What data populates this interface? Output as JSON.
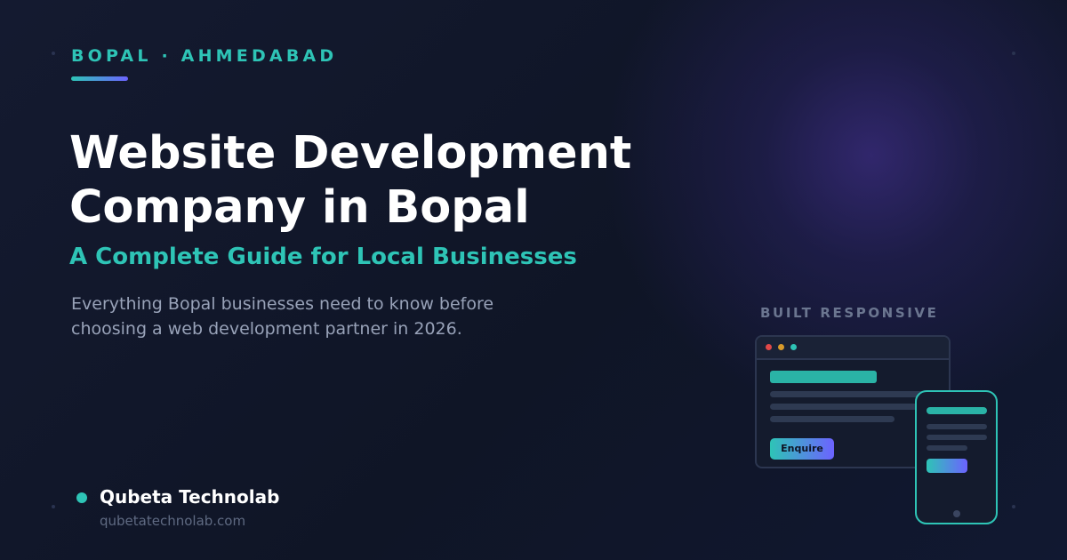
{
  "location": {
    "label": "BOPAL · AHMEDABAD"
  },
  "hero": {
    "title_lines": [
      "Website Development",
      "Company in Bopal"
    ],
    "subtitle": "A Complete Guide for Local Businesses",
    "description_lines": [
      "Everything Bopal businesses need to know before",
      "choosing a web development partner in 2026."
    ]
  },
  "illustration": {
    "heading": "BUILT RESPONSIVE",
    "browser_button_label": "Enquire"
  },
  "brand": {
    "name": "Qubeta Technolab",
    "url": "qubetatechnolab.com"
  },
  "colors": {
    "accent_teal": "#2ec4b6",
    "accent_purple": "#6c63ff",
    "background": "#0f1425"
  }
}
